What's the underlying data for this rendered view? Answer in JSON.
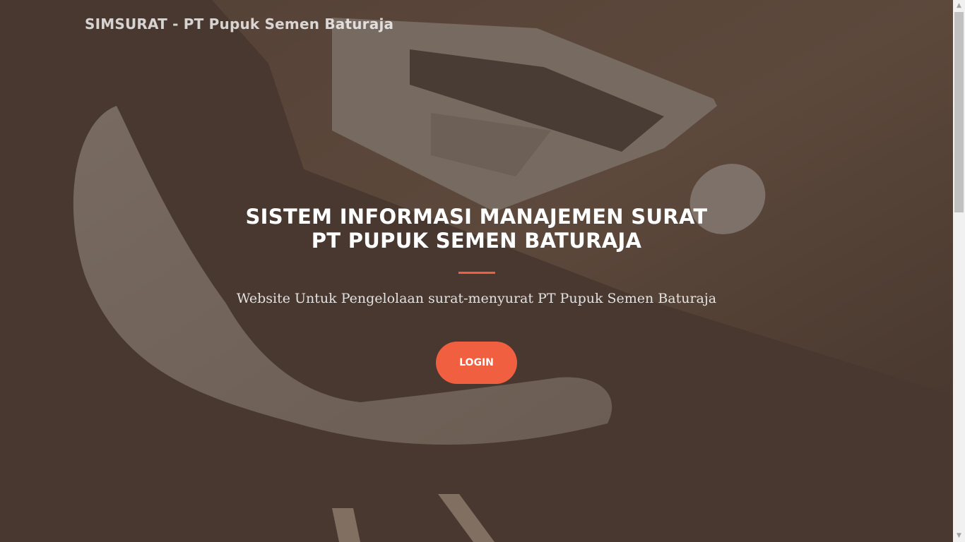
{
  "navbar": {
    "brand": "SIMSURAT - PT Pupuk Semen Baturaja"
  },
  "hero": {
    "title_line1": "SISTEM INFORMASI MANAJEMEN SURAT",
    "title_line2": "PT PUPUK SEMEN BATURAJA",
    "subtitle": "Website Untuk Pengelolaan surat-menyurat PT Pupuk Semen Baturaja",
    "login_label": "LOGIN"
  },
  "colors": {
    "accent": "#f05f40",
    "overlay": "#46342a"
  },
  "scrollbar": {
    "up_icon": "chevron-up-icon",
    "down_icon": "chevron-down-icon"
  }
}
